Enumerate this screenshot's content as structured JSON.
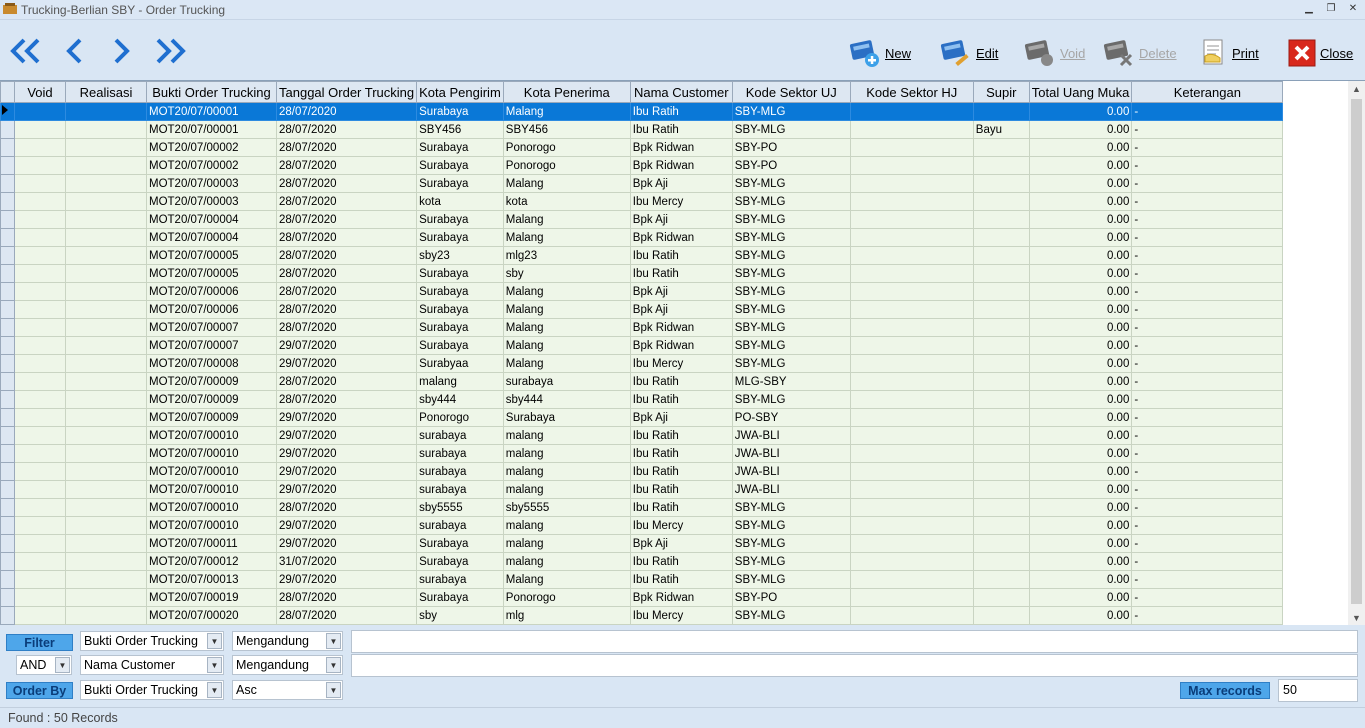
{
  "window": {
    "title": "Trucking-Berlian SBY - Order Trucking"
  },
  "toolbar": {
    "new_label": "New",
    "edit_label": "Edit",
    "void_label": "Void",
    "delete_label": "Delete",
    "print_label": "Print",
    "close_label": "Close"
  },
  "table": {
    "columns": [
      "Void",
      "Realisasi",
      "Bukti Order Trucking",
      "Tanggal Order Trucking",
      "Kota Pengirim",
      "Kota Penerima",
      "Nama Customer",
      "Kode Sektor UJ",
      "Kode Sektor HJ",
      "Supir",
      "Total Uang Muka",
      "Keterangan"
    ],
    "rows": [
      [
        "",
        "",
        "MOT20/07/00001",
        "28/07/2020",
        "Surabaya",
        "Malang",
        "Ibu Ratih",
        "SBY-MLG",
        "",
        "",
        "0.00",
        "-"
      ],
      [
        "",
        "",
        "MOT20/07/00001",
        "28/07/2020",
        "SBY456",
        "SBY456",
        "Ibu Ratih",
        "SBY-MLG",
        "",
        "Bayu",
        "0.00",
        "-"
      ],
      [
        "",
        "",
        "MOT20/07/00002",
        "28/07/2020",
        "Surabaya",
        "Ponorogo",
        "Bpk Ridwan",
        "SBY-PO",
        "",
        "",
        "0.00",
        "-"
      ],
      [
        "",
        "",
        "MOT20/07/00002",
        "28/07/2020",
        "Surabaya",
        "Ponorogo",
        "Bpk Ridwan",
        "SBY-PO",
        "",
        "",
        "0.00",
        "-"
      ],
      [
        "",
        "",
        "MOT20/07/00003",
        "28/07/2020",
        "Surabaya",
        "Malang",
        "Bpk Aji",
        "SBY-MLG",
        "",
        "",
        "0.00",
        "-"
      ],
      [
        "",
        "",
        "MOT20/07/00003",
        "28/07/2020",
        "kota",
        "kota",
        "Ibu Mercy",
        "SBY-MLG",
        "",
        "",
        "0.00",
        "-"
      ],
      [
        "",
        "",
        "MOT20/07/00004",
        "28/07/2020",
        "Surabaya",
        "Malang",
        "Bpk Aji",
        "SBY-MLG",
        "",
        "",
        "0.00",
        "-"
      ],
      [
        "",
        "",
        "MOT20/07/00004",
        "28/07/2020",
        "Surabaya",
        "Malang",
        "Bpk Ridwan",
        "SBY-MLG",
        "",
        "",
        "0.00",
        "-"
      ],
      [
        "",
        "",
        "MOT20/07/00005",
        "28/07/2020",
        "sby23",
        "mlg23",
        "Ibu Ratih",
        "SBY-MLG",
        "",
        "",
        "0.00",
        "-"
      ],
      [
        "",
        "",
        "MOT20/07/00005",
        "28/07/2020",
        "Surabaya",
        "sby",
        "Ibu Ratih",
        "SBY-MLG",
        "",
        "",
        "0.00",
        "-"
      ],
      [
        "",
        "",
        "MOT20/07/00006",
        "28/07/2020",
        "Surabaya",
        "Malang",
        "Bpk Aji",
        "SBY-MLG",
        "",
        "",
        "0.00",
        "-"
      ],
      [
        "",
        "",
        "MOT20/07/00006",
        "28/07/2020",
        "Surabaya",
        "Malang",
        "Bpk Aji",
        "SBY-MLG",
        "",
        "",
        "0.00",
        "-"
      ],
      [
        "",
        "",
        "MOT20/07/00007",
        "28/07/2020",
        "Surabaya",
        "Malang",
        "Bpk Ridwan",
        "SBY-MLG",
        "",
        "",
        "0.00",
        "-"
      ],
      [
        "",
        "",
        "MOT20/07/00007",
        "29/07/2020",
        "Surabaya",
        "Malang",
        "Bpk Ridwan",
        "SBY-MLG",
        "",
        "",
        "0.00",
        "-"
      ],
      [
        "",
        "",
        "MOT20/07/00008",
        "29/07/2020",
        "Surabyaa",
        "Malang",
        "Ibu Mercy",
        "SBY-MLG",
        "",
        "",
        "0.00",
        "-"
      ],
      [
        "",
        "",
        "MOT20/07/00009",
        "28/07/2020",
        "malang",
        "surabaya",
        "Ibu Ratih",
        "MLG-SBY",
        "",
        "",
        "0.00",
        "-"
      ],
      [
        "",
        "",
        "MOT20/07/00009",
        "28/07/2020",
        "sby444",
        "sby444",
        "Ibu Ratih",
        "SBY-MLG",
        "",
        "",
        "0.00",
        "-"
      ],
      [
        "",
        "",
        "MOT20/07/00009",
        "29/07/2020",
        "Ponorogo",
        "Surabaya",
        "Bpk Aji",
        "PO-SBY",
        "",
        "",
        "0.00",
        "-"
      ],
      [
        "",
        "",
        "MOT20/07/00010",
        "29/07/2020",
        "surabaya",
        "malang",
        "Ibu Ratih",
        "JWA-BLI",
        "",
        "",
        "0.00",
        "-"
      ],
      [
        "",
        "",
        "MOT20/07/00010",
        "29/07/2020",
        "surabaya",
        "malang",
        "Ibu Ratih",
        "JWA-BLI",
        "",
        "",
        "0.00",
        "-"
      ],
      [
        "",
        "",
        "MOT20/07/00010",
        "29/07/2020",
        "surabaya",
        "malang",
        "Ibu Ratih",
        "JWA-BLI",
        "",
        "",
        "0.00",
        "-"
      ],
      [
        "",
        "",
        "MOT20/07/00010",
        "29/07/2020",
        "surabaya",
        "malang",
        "Ibu Ratih",
        "JWA-BLI",
        "",
        "",
        "0.00",
        "-"
      ],
      [
        "",
        "",
        "MOT20/07/00010",
        "28/07/2020",
        "sby5555",
        "sby5555",
        "Ibu Ratih",
        "SBY-MLG",
        "",
        "",
        "0.00",
        "-"
      ],
      [
        "",
        "",
        "MOT20/07/00010",
        "29/07/2020",
        "surabaya",
        "malang",
        "Ibu Mercy",
        "SBY-MLG",
        "",
        "",
        "0.00",
        "-"
      ],
      [
        "",
        "",
        "MOT20/07/00011",
        "29/07/2020",
        "Surabaya",
        "malang",
        "Bpk Aji",
        "SBY-MLG",
        "",
        "",
        "0.00",
        "-"
      ],
      [
        "",
        "",
        "MOT20/07/00012",
        "31/07/2020",
        "Surabaya",
        "malang",
        "Ibu Ratih",
        "SBY-MLG",
        "",
        "",
        "0.00",
        "-"
      ],
      [
        "",
        "",
        "MOT20/07/00013",
        "29/07/2020",
        "surabaya",
        "Malang",
        "Ibu Ratih",
        "SBY-MLG",
        "",
        "",
        "0.00",
        "-"
      ],
      [
        "",
        "",
        "MOT20/07/00019",
        "28/07/2020",
        "Surabaya",
        "Ponorogo",
        "Bpk Ridwan",
        "SBY-PO",
        "",
        "",
        "0.00",
        "-"
      ],
      [
        "",
        "",
        "MOT20/07/00020",
        "28/07/2020",
        "sby",
        "mlg",
        "Ibu Mercy",
        "SBY-MLG",
        "",
        "",
        "0.00",
        "-"
      ]
    ]
  },
  "filter": {
    "filter_label": "Filter",
    "field1": "Bukti Order Trucking",
    "op1": "Mengandung",
    "value1": "",
    "logic": "AND",
    "field2": "Nama Customer",
    "op2": "Mengandung",
    "value2": "",
    "orderby_label": "Order By",
    "order_field": "Bukti Order Trucking",
    "order_dir": "Asc",
    "maxrec_label": "Max records",
    "maxrec_value": "50"
  },
  "status": {
    "text": "Found : 50 Records"
  }
}
